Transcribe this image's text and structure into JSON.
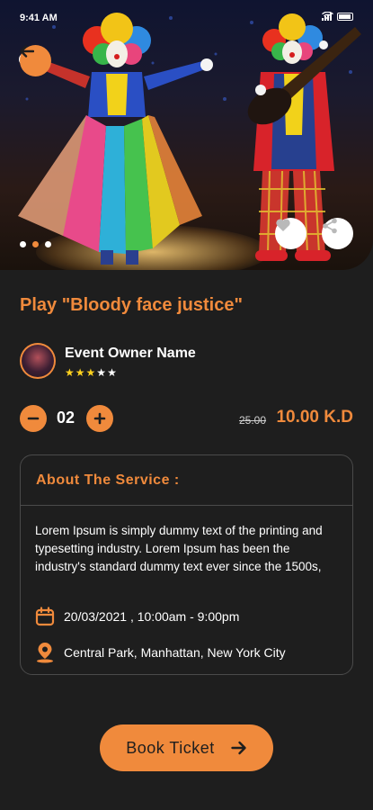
{
  "status": {
    "time": "9:41 AM"
  },
  "hero": {
    "image_alt": "Two clowns performing on stage",
    "carousel_total": 3,
    "carousel_active": 1
  },
  "event": {
    "title": "Play \"Bloody face justice\"",
    "owner_name": "Event Owner Name",
    "rating": 3,
    "rating_max": 5
  },
  "ticket": {
    "quantity": "02",
    "old_price": "25.00",
    "price": "10.00 K.D"
  },
  "about": {
    "heading": "About The Service :",
    "description": "Lorem Ipsum is simply dummy text of the printing and typesetting industry. Lorem Ipsum has been the industry's standard dummy text ever since the 1500s,",
    "datetime": "20/03/2021 , 10:00am - 9:00pm",
    "location": "Central Park, Manhattan, New York City"
  },
  "cta": {
    "book_label": "Book Ticket"
  },
  "icons": {
    "back": "arrow-left-icon",
    "favorite": "heart-icon",
    "share": "share-icon",
    "decrease": "minus-icon",
    "increase": "plus-icon",
    "calendar": "calendar-icon",
    "location": "location-pin-icon",
    "book_arrow": "arrow-right-icon"
  },
  "colors": {
    "accent": "#f08a3c",
    "background": "#1e1e1e",
    "star": "#ffd21f",
    "card_border": "#4a4a4a"
  }
}
